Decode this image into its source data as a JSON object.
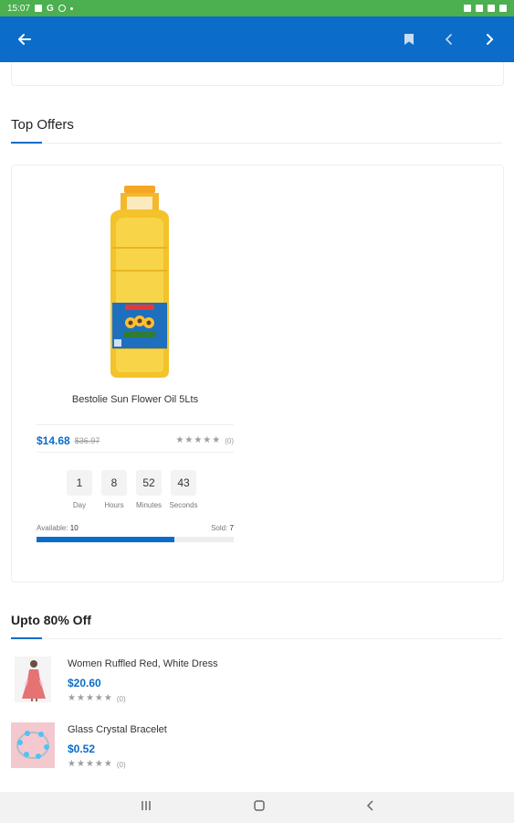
{
  "status_bar": {
    "time": "15:07"
  },
  "app_bar": {
    "back_icon": "arrow-left-icon",
    "bookmark_icon": "bookmark-icon",
    "prev_icon": "chevron-left-icon",
    "next_icon": "chevron-right-icon",
    "color": "#0b6cc9"
  },
  "top_offers": {
    "title": "Top Offers",
    "product": {
      "name": "Bestolie Sun Flower Oil 5Lts",
      "price": "$14.68",
      "old_price": "$36.97",
      "rating_count": "(0)",
      "countdown": [
        {
          "value": "1",
          "label": "Day"
        },
        {
          "value": "8",
          "label": "Hours"
        },
        {
          "value": "52",
          "label": "Minutes"
        },
        {
          "value": "43",
          "label": "Seconds"
        }
      ],
      "available_label": "Available:",
      "available_value": "10",
      "sold_label": "Sold:",
      "sold_value": "7",
      "sold_fraction": 0.7
    }
  },
  "upto_off": {
    "title": "Upto 80% Off",
    "items": [
      {
        "name": "Women Ruffled Red, White Dress",
        "price": "$20.60",
        "rating_count": "(0)"
      },
      {
        "name": "Glass Crystal Bracelet",
        "price": "$0.52",
        "rating_count": "(0)"
      }
    ]
  },
  "nav_bar": {
    "recents_icon": "recents-icon",
    "home_icon": "home-icon",
    "back_icon": "back-chevron-icon"
  },
  "colors": {
    "accent": "#0b6cc9",
    "status_bar": "#4caf50"
  }
}
